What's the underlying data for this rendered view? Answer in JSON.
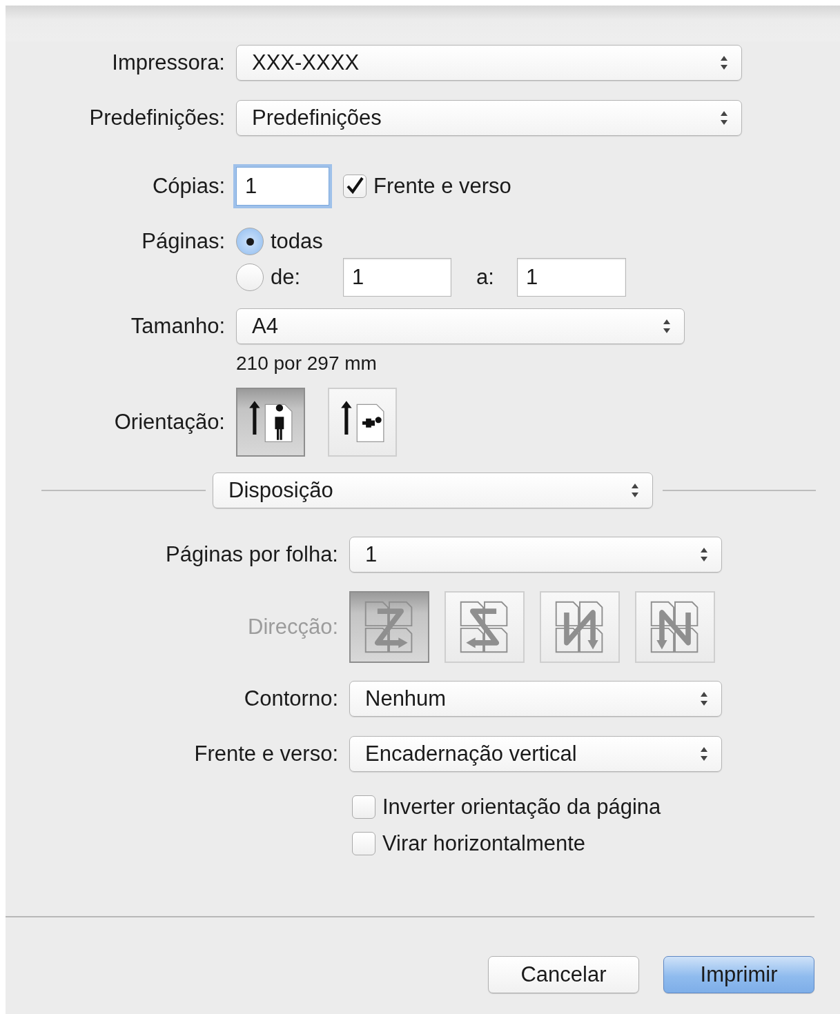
{
  "printer": {
    "label": "Impressora:",
    "value": "XXX-XXXX"
  },
  "presets": {
    "label": "Predefinições:",
    "value": "Predefinições"
  },
  "copies": {
    "label": "Cópias:",
    "value": "1",
    "focused": true
  },
  "two_sided_check": {
    "label": "Frente e verso",
    "checked": true
  },
  "pages": {
    "label": "Páginas:",
    "options": [
      {
        "label": "todas",
        "selected": true
      },
      {
        "label": "de:",
        "selected": false
      }
    ],
    "from": "1",
    "to_label": "a:",
    "to": "1"
  },
  "paper_size": {
    "label": "Tamanho:",
    "value": "A4",
    "dimensions": "210 por 297 mm"
  },
  "orientation": {
    "label": "Orientação:",
    "options": [
      {
        "kind": "portrait",
        "selected": true
      },
      {
        "kind": "landscape",
        "selected": false
      }
    ]
  },
  "section": {
    "value": "Disposição"
  },
  "layout": {
    "pages_per_sheet": {
      "label": "Páginas por folha:",
      "value": "1"
    },
    "direction": {
      "label": "Direcção:",
      "disabled": true,
      "options": [
        {
          "kind": "z",
          "selected": true
        },
        {
          "kind": "z-reverse",
          "selected": false
        },
        {
          "kind": "n-down",
          "selected": false
        },
        {
          "kind": "n-reverse",
          "selected": false
        }
      ]
    },
    "border": {
      "label": "Contorno:",
      "value": "Nenhum"
    },
    "two_sided": {
      "label": "Frente e verso:",
      "value": "Encadernação vertical"
    },
    "checkboxes": [
      {
        "label": "Inverter orientação da página",
        "checked": false
      },
      {
        "label": "Virar horizontalmente",
        "checked": false
      }
    ]
  },
  "buttons": [
    {
      "label": "Cancelar",
      "kind": "default"
    },
    {
      "label": "Imprimir",
      "kind": "primary"
    }
  ]
}
